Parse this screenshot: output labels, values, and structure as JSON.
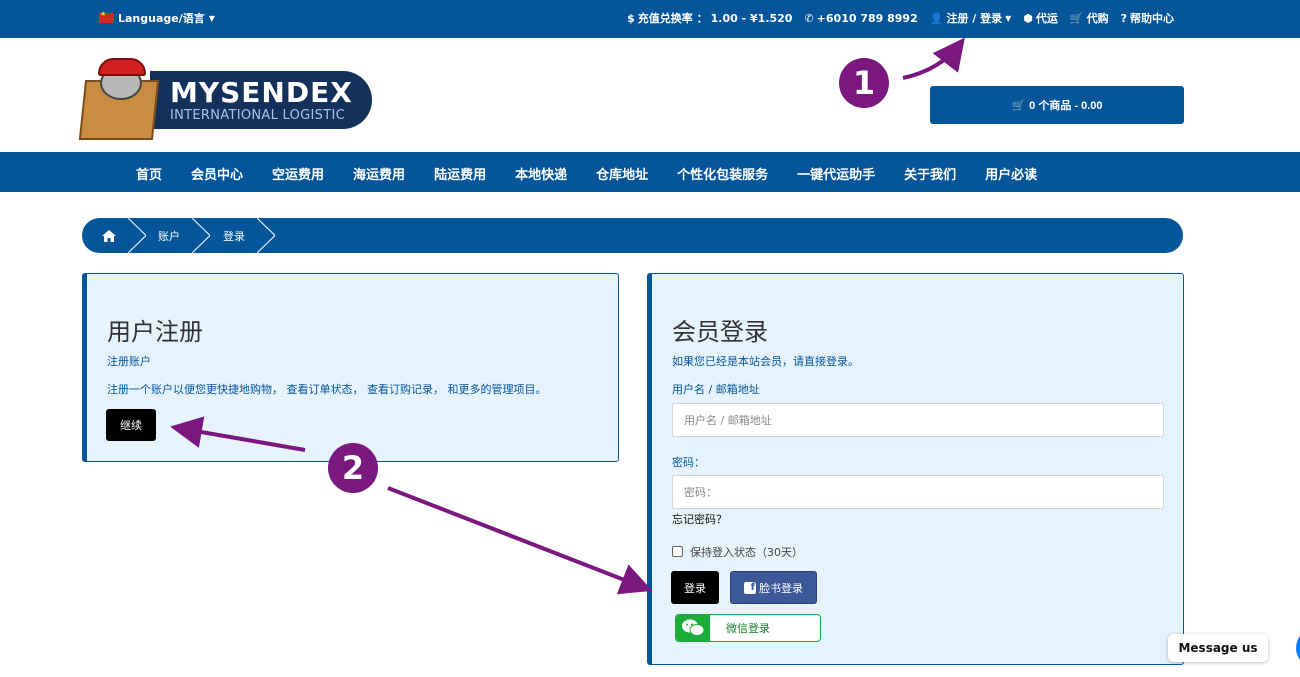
{
  "topbar": {
    "language": "Language/语言",
    "rate_label": "充值兑换率 ：",
    "rate_value": "1.00 - ¥1.520",
    "phone": "+6010 789 8992",
    "login_register": "注册 / 登录",
    "daiyun": "代运",
    "daigou": "代购",
    "help": "帮助中心"
  },
  "logo": {
    "brand": "MYSENDEX",
    "tagline": "INTERNATIONAL LOGISTIC"
  },
  "cart": {
    "label": "0 个商品 - 0.00"
  },
  "nav": {
    "items": [
      "首页",
      "会员中心",
      "空运费用",
      "海运费用",
      "陆运费用",
      "本地快递",
      "仓库地址",
      "个性化包装服务",
      "一键代运助手",
      "关于我们",
      "用户必读"
    ]
  },
  "breadcrumb": {
    "account": "账户",
    "login": "登录"
  },
  "register": {
    "title": "用户注册",
    "subtitle": "注册账户",
    "description": "注册一个账户以便您更快捷地购物， 查看订单状态， 查看订购记录， 和更多的管理项目。",
    "continue_label": "继续"
  },
  "login": {
    "title": "会员登录",
    "intro": "如果您已经是本站会员，请直接登录。",
    "username_label": "用户名 / 邮箱地址",
    "username_placeholder": "用户名 / 邮箱地址",
    "password_label": "密码：",
    "password_placeholder": "密码：",
    "forgot": "忘记密码？",
    "remember": "保持登入状态（30天）",
    "login_label": "登录",
    "facebook_label": "脸书登录",
    "wechat_label": "微信登录"
  },
  "messenger": {
    "label": "Message us"
  },
  "annotations": {
    "badge1": "1",
    "badge2": "2",
    "color": "#7b1880"
  },
  "colors": {
    "primary": "#05559a",
    "panel_bg": "#e6f2fc",
    "facebook": "#3b5898",
    "wechat": "#1dab3a"
  }
}
